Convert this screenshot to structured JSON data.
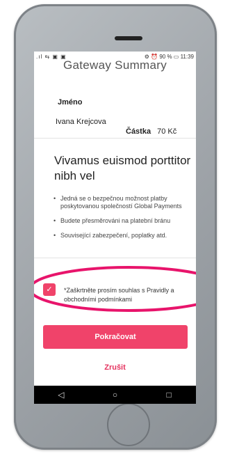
{
  "status_bar": {
    "left_icons": ".ıl ⇆ ▣ ▣",
    "right_text": "⚙ ⏰ 90 % ▭ 11:39"
  },
  "header": {
    "title": "Gateway Summary"
  },
  "summary": {
    "name_label": "Jméno",
    "name_value": "Ivana Krejcova",
    "amount_label": "Částka",
    "amount_value": "70 Kč"
  },
  "info": {
    "heading": "Vivamus euismod porttitor nibh vel",
    "bullets": [
      "Jedná se o bezpečnou možnost platby poskytovanou společností Global Payments",
      "Budete přesměrováni na platební bránu",
      "Související zabezpečení, poplatky atd."
    ]
  },
  "consent": {
    "checked": true,
    "check_glyph": "✓",
    "text": "*Zaškrtněte prosím souhlas s Pravidly a obchodními podmínkami"
  },
  "actions": {
    "continue_label": "Pokračovat",
    "cancel_label": "Zrušit"
  },
  "nav": {
    "back_glyph": "◁",
    "home_glyph": "○",
    "recents_glyph": "□"
  },
  "colors": {
    "accent": "#f0436a",
    "highlight_ring": "#e8146b"
  }
}
